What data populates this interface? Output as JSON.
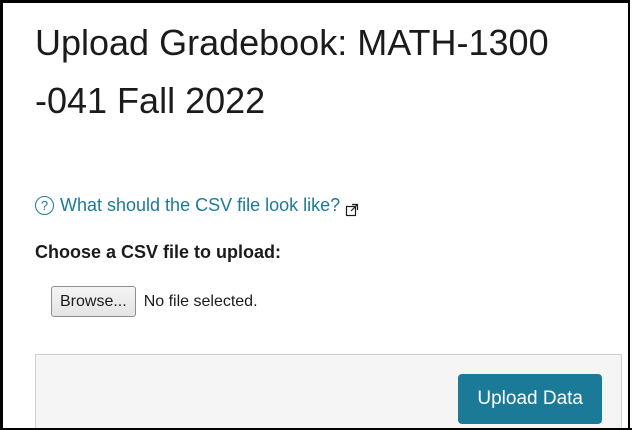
{
  "page": {
    "title": "Upload Gradebook: MATH-1300 -041 Fall 2022"
  },
  "help": {
    "icon": "question-circle-icon",
    "link_text": "What should the CSV file look like?",
    "external_icon": "external-link-icon"
  },
  "form": {
    "file_label": "Choose a CSV file to upload:",
    "browse_label": "Browse...",
    "file_status": "No file selected."
  },
  "footer": {
    "upload_label": "Upload Data"
  },
  "colors": {
    "accent": "#1c7a99",
    "footer_bg": "#f5f5f5"
  }
}
